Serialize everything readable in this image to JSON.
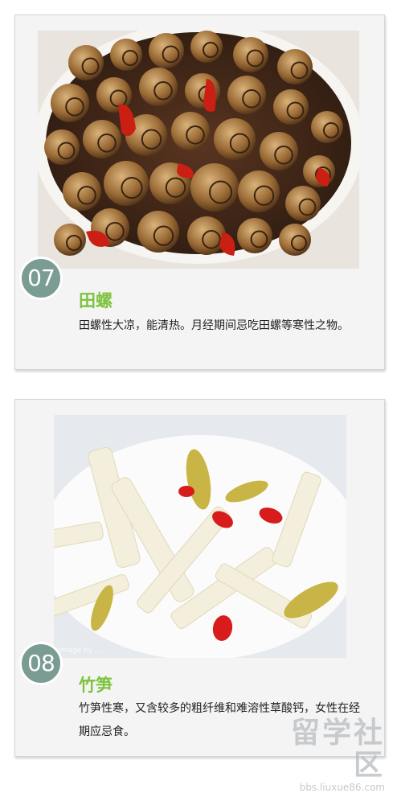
{
  "items": [
    {
      "number": "07",
      "title": "田螺",
      "description": "田螺性大凉，能清热。月经期间忌吃田螺等寒性之物。",
      "image": "stir-fried-snails-with-chili-photo"
    },
    {
      "number": "08",
      "title": "竹笋",
      "description": "竹笋性寒，又含较多的粗纤维和难溶性草酸钙，女性在经期应忌食。",
      "image": "pickled-bamboo-shoots-with-peppers-photo",
      "photo_watermark": "Image by ..."
    }
  ],
  "site_watermark": {
    "logo_text": "留学社区",
    "url": "bbs.liuxue86.com"
  },
  "colors": {
    "badge": "#7a9c93",
    "title": "#7dc33c",
    "card_bg": "#f4f4f4"
  }
}
